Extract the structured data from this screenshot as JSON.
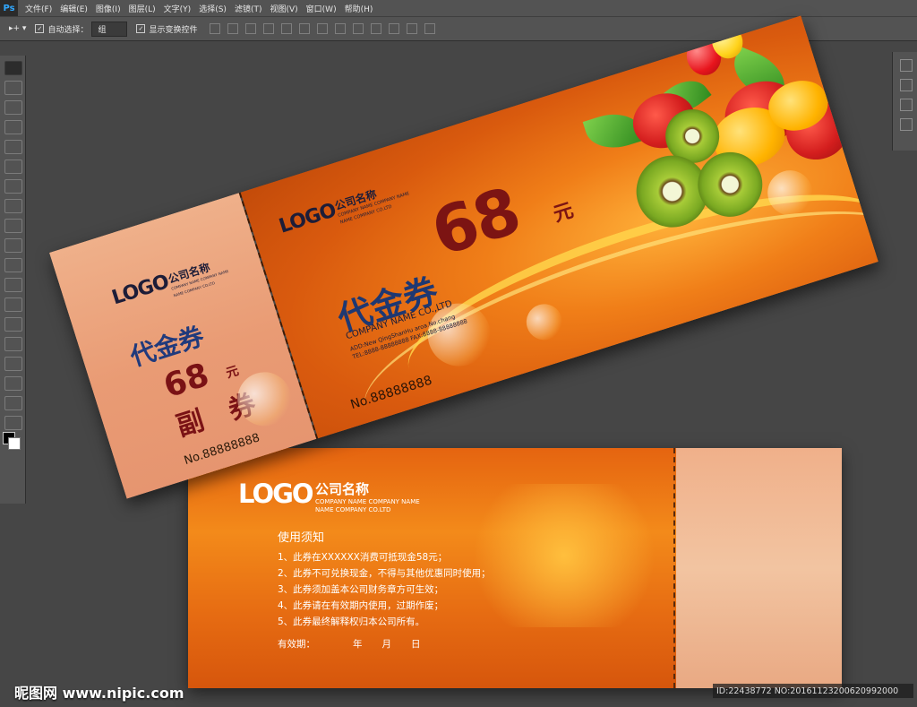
{
  "app": {
    "logo": "Ps"
  },
  "menu": [
    "文件(F)",
    "编辑(E)",
    "图像(I)",
    "图层(L)",
    "文字(Y)",
    "选择(S)",
    "滤镜(T)",
    "视图(V)",
    "窗口(W)",
    "帮助(H)"
  ],
  "options": {
    "tool_arrow": "▸+ ▾",
    "auto_select_label": "自动选择：",
    "auto_select_value": "组",
    "show_transform_label": "显示变换控件",
    "auto_select_checked": "✓",
    "show_transform_checked": "✓"
  },
  "front": {
    "stub": {
      "logo": "LOGO",
      "company": "公司名称",
      "company_en": "COMPANY NAME COMPANY NAME\nNAME COMPANY CO.LTD",
      "title": "代金券",
      "amount": "68",
      "unit": "元",
      "copy_label": "副 券",
      "serial": "No.88888888"
    },
    "main": {
      "logo": "LOGO",
      "company": "公司名称",
      "company_en": "COMPANY NAME COMPANY NAME\nNAME COMPANY CO.LTD",
      "amount": "68",
      "unit": "元",
      "title": "代金券",
      "company_name": "COMPANY NAME CO.,LTD",
      "address": "ADD:New QingShanHu aroa.No.chang\nTEL:8888-88888888  FAX:8888-88888888",
      "serial": "No.88888888"
    }
  },
  "back": {
    "logo": "LOGO",
    "company": "公司名称",
    "company_en": "COMPANY NAME COMPANY NAME\nNAME COMPANY CO.LTD",
    "rules_title": "使用须知",
    "rules": [
      "1、此券在XXXXXX消费可抵现金58元；",
      "2、此券不可兑换现金，不得与其他优惠同时使用；",
      "3、此券须加盖本公司财务章方可生效；",
      "4、此券请在有效期内使用，过期作废；",
      "5、此券最终解释权归本公司所有。"
    ],
    "validity_label": "有效期：",
    "year": "年",
    "month": "月",
    "day": "日"
  },
  "watermark": {
    "site": "昵图网 www.nipic.com",
    "id": "ID:22438772 NO:20161123200620992000"
  },
  "colors": {
    "orange": "#e56410",
    "stub": "#efb08a",
    "navy": "#1e3872",
    "maroon": "#7c1413"
  },
  "icons": [
    "move-icon",
    "marquee-icon",
    "lasso-icon",
    "quick-select-icon",
    "crop-icon",
    "eyedropper-icon",
    "brush-icon",
    "stamp-icon",
    "history-brush-icon",
    "eraser-icon",
    "bucket-icon",
    "blur-icon",
    "dodge-icon",
    "pen-icon",
    "type-icon",
    "path-select-icon",
    "rectangle-icon",
    "hand-icon",
    "zoom-icon"
  ]
}
